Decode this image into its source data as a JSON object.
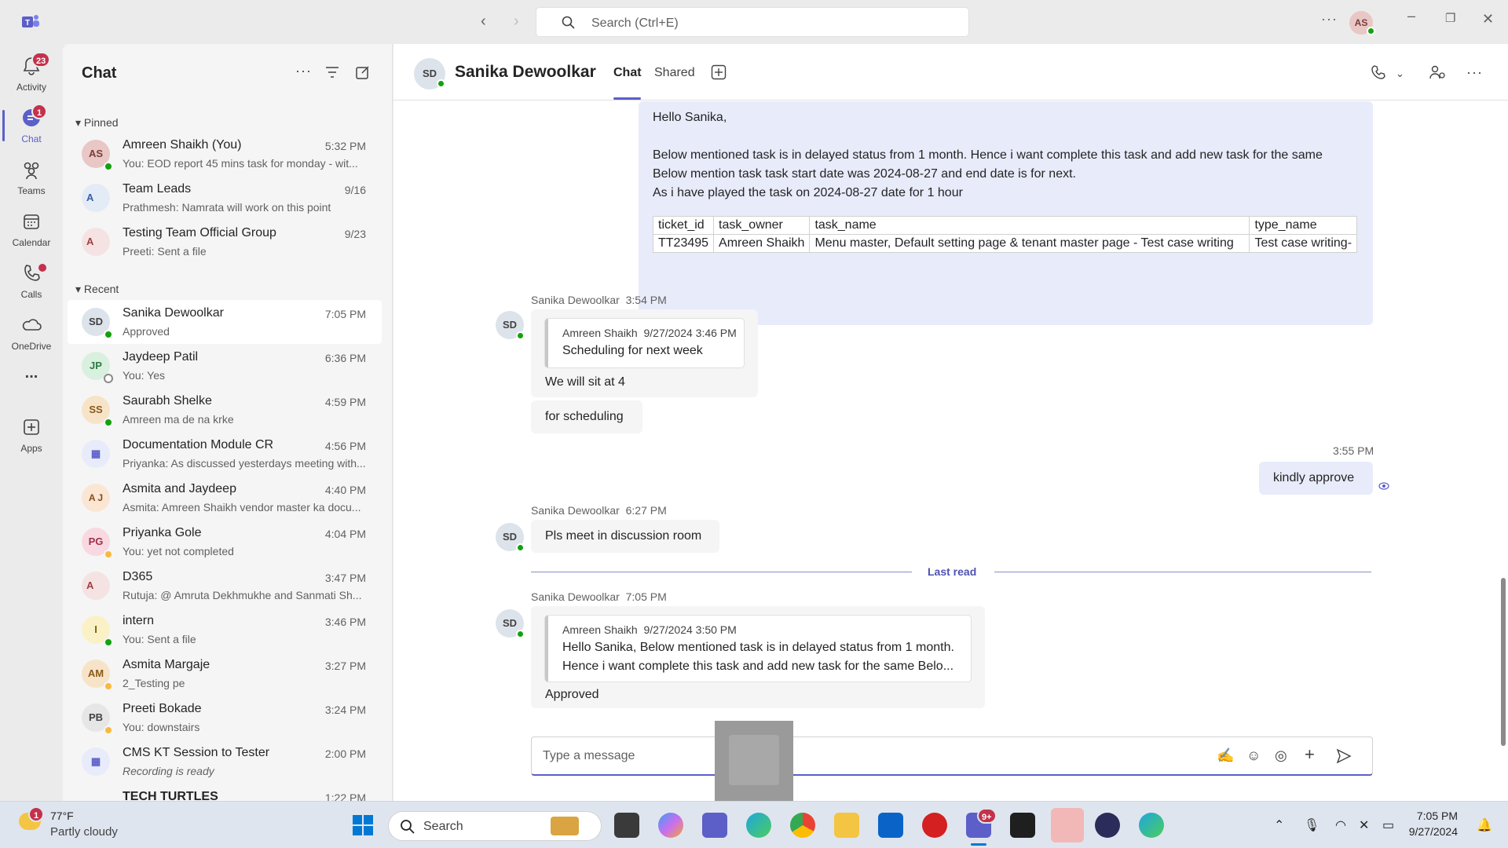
{
  "titlebar": {
    "search_placeholder": "Search (Ctrl+E)",
    "user_initials": "AS"
  },
  "rail": [
    {
      "label": "Activity",
      "badge": "23"
    },
    {
      "label": "Chat",
      "badge": "1"
    },
    {
      "label": "Teams",
      "badge": ""
    },
    {
      "label": "Calendar",
      "badge": ""
    },
    {
      "label": "Calls",
      "badge": ""
    },
    {
      "label": "OneDrive",
      "badge": ""
    },
    {
      "label": "...",
      "badge": ""
    },
    {
      "label": "Apps",
      "badge": ""
    }
  ],
  "chatlist": {
    "title": "Chat",
    "pinned_label": "Pinned",
    "recent_label": "Recent",
    "pinned": [
      {
        "initials": "AS",
        "name": "Amreen Shaikh (You)",
        "preview": "You: EOD report 45 mins task for monday - wit...",
        "time": "5:32 PM"
      },
      {
        "initials": "A",
        "name": "Team Leads",
        "preview": "Prathmesh: Namrata will work on this point",
        "time": "9/16"
      },
      {
        "initials": "A",
        "name": "Testing Team Official Group",
        "preview": "Preeti: Sent a file",
        "time": "9/23"
      }
    ],
    "recent": [
      {
        "initials": "SD",
        "name": "Sanika Dewoolkar",
        "preview": "Approved",
        "time": "7:05 PM"
      },
      {
        "initials": "JP",
        "name": "Jaydeep Patil",
        "preview": "You: Yes",
        "time": "6:36 PM"
      },
      {
        "initials": "SS",
        "name": "Saurabh Shelke",
        "preview": "Amreen ma de na krke",
        "time": "4:59 PM"
      },
      {
        "initials": "",
        "name": "Documentation Module CR",
        "preview": "Priyanka: As discussed yesterdays meeting with...",
        "time": "4:56 PM"
      },
      {
        "initials": "A J",
        "name": "Asmita and Jaydeep",
        "preview": "Asmita: Amreen Shaikh vendor master ka docu...",
        "time": "4:40 PM"
      },
      {
        "initials": "PG",
        "name": "Priyanka Gole",
        "preview": "You: yet not completed",
        "time": "4:04 PM"
      },
      {
        "initials": "A",
        "name": "D365",
        "preview": "Rutuja: @ Amruta Dekhmukhe and Sanmati Sh...",
        "time": "3:47 PM"
      },
      {
        "initials": "I",
        "name": "intern",
        "preview": "You: Sent a file",
        "time": "3:46 PM"
      },
      {
        "initials": "AM",
        "name": "Asmita Margaje",
        "preview": "2_Testing pe",
        "time": "3:27 PM"
      },
      {
        "initials": "PB",
        "name": "Preeti Bokade",
        "preview": "You: downstairs",
        "time": "3:24 PM"
      },
      {
        "initials": "",
        "name": "CMS KT Session to Tester",
        "preview": "Recording is ready",
        "time": "2:00 PM"
      },
      {
        "initials": "",
        "name": "TECH TURTLES",
        "preview": "",
        "time": "1:22 PM"
      }
    ]
  },
  "conversation": {
    "initials": "SD",
    "name": "Sanika Dewoolkar",
    "tabs": [
      "Chat",
      "Shared"
    ],
    "top_message": {
      "greeting": "Hello Sanika,",
      "line1": "Below mentioned task is in delayed status from 1 month. Hence i want complete this task and add new task for the same",
      "line2": "Below mention task task start date was 2024-08-27 and end date is for next.",
      "line3": "As i have played the task on 2024-08-27 date for 1 hour",
      "table_headers": [
        "ticket_id",
        "task_owner",
        "task_name",
        "type_name"
      ],
      "table_row": [
        "TT23495",
        "Amreen Shaikh",
        "Menu master, Default setting page & tenant master page - Test case writing",
        "Test case writing-"
      ]
    },
    "msg1": {
      "sender": "Sanika Dewoolkar",
      "time": "3:54 PM",
      "quote_author": "Amreen Shaikh",
      "quote_time": "9/27/2024 3:46 PM",
      "quote_text": "Scheduling for next week",
      "text": "We will sit at 4",
      "text2": "for scheduling"
    },
    "mine": {
      "time": "3:55 PM",
      "text": "kindly approve"
    },
    "msg2": {
      "sender": "Sanika Dewoolkar",
      "time": "6:27 PM",
      "text": "Pls meet in discussion room"
    },
    "last_read": "Last read",
    "msg3": {
      "sender": "Sanika Dewoolkar",
      "time": "7:05 PM",
      "quote_author": "Amreen Shaikh",
      "quote_time": "9/27/2024 3:50 PM",
      "quote_line1": "Hello Sanika, Below mentioned task is in delayed status from 1 month.",
      "quote_line2": "Hence i want complete this task and add new task for the same Belo...",
      "text": "Approved"
    },
    "composer_placeholder": "Type a message"
  },
  "taskbar": {
    "weather_temp": "77°F",
    "weather_desc": "Partly cloudy",
    "weather_badge": "1",
    "search": "Search",
    "teams_badge": "9+",
    "time": "7:05 PM",
    "date": "9/27/2024"
  },
  "colors": {
    "accent": "#5b5fc7",
    "presence_available": "#13a10e",
    "presence_away": "#f8b940",
    "badge": "#c4314b"
  }
}
